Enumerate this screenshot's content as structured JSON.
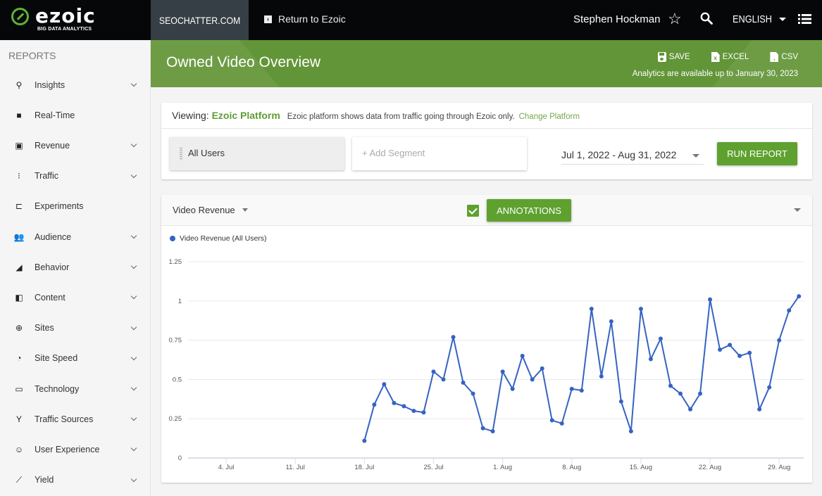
{
  "topbar": {
    "logo_text": "ezoic",
    "logo_sub": "BIG DATA ANALYTICS",
    "site": "SEOCHATTER.COM",
    "return_label": "Return to Ezoic",
    "user_name": "Stephen Hockman",
    "language": "ENGLISH"
  },
  "sidebar": {
    "header": "REPORTS",
    "items": [
      {
        "label": "Insights",
        "icon": "search-icon",
        "glyph": "⚲",
        "expandable": true
      },
      {
        "label": "Real-Time",
        "icon": "video-camera-icon",
        "glyph": "■",
        "expandable": false
      },
      {
        "label": "Revenue",
        "icon": "money-icon",
        "glyph": "▣",
        "expandable": true
      },
      {
        "label": "Traffic",
        "icon": "traffic-light-icon",
        "glyph": "⁝",
        "expandable": true
      },
      {
        "label": "Experiments",
        "icon": "flask-icon",
        "glyph": "⊏",
        "expandable": false
      },
      {
        "label": "Audience",
        "icon": "people-icon",
        "glyph": "👥",
        "expandable": true
      },
      {
        "label": "Behavior",
        "icon": "area-chart-icon",
        "glyph": "◢",
        "expandable": true
      },
      {
        "label": "Content",
        "icon": "dashboard-tile-icon",
        "glyph": "◧",
        "expandable": true
      },
      {
        "label": "Sites",
        "icon": "globe-icon",
        "glyph": "⊕",
        "expandable": true
      },
      {
        "label": "Site Speed",
        "icon": "speedometer-icon",
        "glyph": "◔",
        "expandable": true
      },
      {
        "label": "Technology",
        "icon": "devices-icon",
        "glyph": "▭",
        "expandable": true
      },
      {
        "label": "Traffic Sources",
        "icon": "fork-icon",
        "glyph": "Y",
        "expandable": true
      },
      {
        "label": "User Experience",
        "icon": "smiley-icon",
        "glyph": "☺",
        "expandable": true
      },
      {
        "label": "Yield",
        "icon": "line-chart-icon",
        "glyph": "⟋",
        "expandable": true
      }
    ]
  },
  "banner": {
    "title": "Owned Video Overview",
    "save_label": "SAVE",
    "excel_label": "EXCEL",
    "csv_label": "CSV",
    "availability": "Analytics are available up to January 30, 2023"
  },
  "viewing": {
    "prefix": "Viewing:",
    "platform": "Ezoic Platform",
    "note": "Ezoic platform shows data from traffic going through Ezoic only.",
    "change_link": "Change Platform"
  },
  "segments": {
    "active": "All Users",
    "add_placeholder": "+ Add Segment"
  },
  "date_range": "Jul 1, 2022 - Aug 31, 2022",
  "run_report_label": "RUN REPORT",
  "chart_panel": {
    "metric": "Video Revenue",
    "annotations_checked": true,
    "annotations_label": "ANNOTATIONS"
  },
  "chart_data": {
    "type": "line",
    "title": "",
    "xlabel": "",
    "ylabel": "",
    "ylim": [
      0,
      1.25
    ],
    "yticks": [
      "0",
      "0.25",
      "0.5",
      "0.75",
      "1",
      "1.25"
    ],
    "ytick_values": [
      0,
      0.25,
      0.5,
      0.75,
      1,
      1.25
    ],
    "x_domain_days": [
      1,
      62
    ],
    "xticks": [
      {
        "label": "4. Jul",
        "day": 4
      },
      {
        "label": "11. Jul",
        "day": 11
      },
      {
        "label": "18. Jul",
        "day": 18
      },
      {
        "label": "25. Jul",
        "day": 25
      },
      {
        "label": "1. Aug",
        "day": 32
      },
      {
        "label": "8. Aug",
        "day": 39
      },
      {
        "label": "15. Aug",
        "day": 46
      },
      {
        "label": "22. Aug",
        "day": 53
      },
      {
        "label": "29. Aug",
        "day": 60
      }
    ],
    "grid": true,
    "legend_position": "top-left",
    "series": [
      {
        "name": "Video Revenue (All Users)",
        "color": "#3663c2",
        "start_day": 18,
        "start_label": "Jul 18, 2022",
        "values": [
          0.11,
          0.34,
          0.47,
          0.35,
          0.33,
          0.3,
          0.29,
          0.55,
          0.5,
          0.77,
          0.48,
          0.41,
          0.19,
          0.17,
          0.55,
          0.44,
          0.65,
          0.5,
          0.57,
          0.24,
          0.22,
          0.44,
          0.43,
          0.95,
          0.52,
          0.87,
          0.36,
          0.17,
          0.95,
          0.63,
          0.76,
          0.46,
          0.41,
          0.31,
          0.41,
          1.01,
          0.69,
          0.72,
          0.65,
          0.67,
          0.31,
          0.45,
          0.75,
          0.94,
          1.03
        ]
      }
    ]
  }
}
